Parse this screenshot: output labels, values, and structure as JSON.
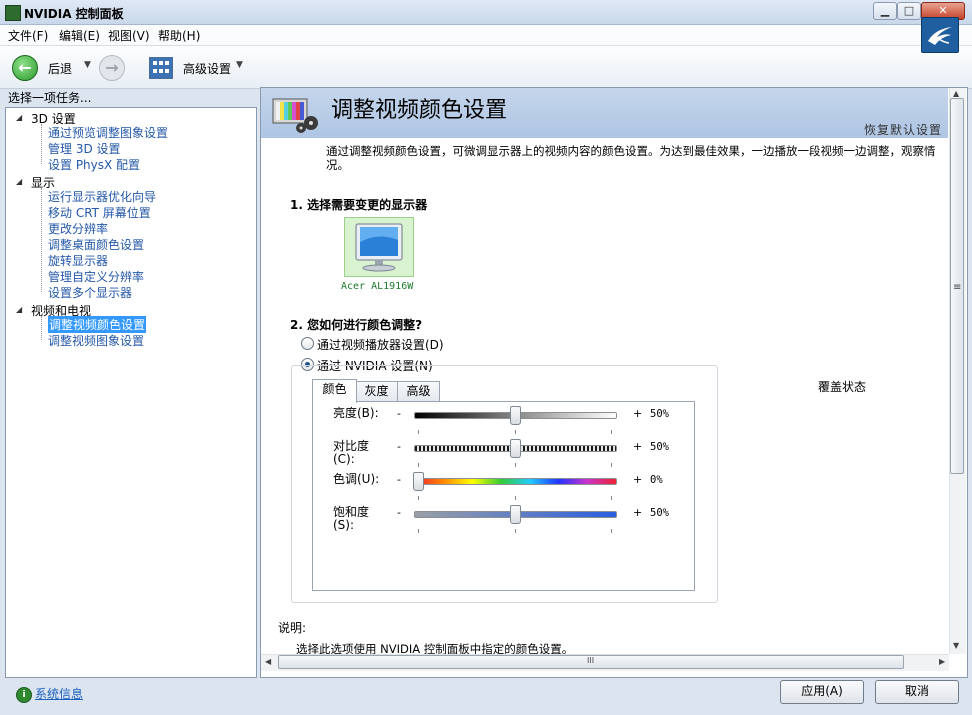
{
  "window": {
    "title": "NVIDIA 控制面板",
    "min": "▁",
    "max": "□",
    "close": "✕"
  },
  "menu": [
    "文件(F)",
    "编辑(E)",
    "视图(V)",
    "帮助(H)"
  ],
  "toolbar": {
    "back_label": "后退",
    "dropdown": "▼",
    "advanced_label": "高级设置"
  },
  "sidebar": {
    "task_label": "选择一项任务...",
    "groups": [
      {
        "label": "3D 设置",
        "toggle": "◢",
        "items": [
          "通过预览调整图象设置",
          "管理 3D 设置",
          "设置 PhysX 配置"
        ]
      },
      {
        "label": "显示",
        "toggle": "◢",
        "items": [
          "运行显示器优化向导",
          "移动 CRT 屏幕位置",
          "更改分辨率",
          "调整桌面颜色设置",
          "旋转显示器",
          "管理自定义分辨率",
          "设置多个显示器"
        ]
      },
      {
        "label": "视频和电视",
        "toggle": "◢",
        "items": [
          "调整视频颜色设置",
          "调整视频图象设置"
        ]
      }
    ],
    "selected_item": "调整视频颜色设置"
  },
  "page": {
    "title": "调整视频颜色设置",
    "restore": "恢复默认设置",
    "intro": "通过调整视频颜色设置，可微调显示器上的视频内容的颜色设置。为达到最佳效果，一边播放一段视频一边调整，观察情况。",
    "section1": "1. 选择需要变更的显示器",
    "monitor_name": "Acer AL1916W",
    "section2": "2. 您如何进行颜色调整?",
    "radio_player": "通过视频播放器设置(D)",
    "radio_nvidia": "通过 NVIDIA 设置(N)",
    "selected_radio": "nvidia",
    "tabs": [
      "颜色",
      "灰度",
      "高级"
    ],
    "active_tab": "颜色",
    "sliders": [
      {
        "label_line1": "亮度(B):",
        "label_line2": "",
        "minus": "-",
        "plus": "+",
        "value_text": "50%",
        "level": 0.5,
        "track": "brightness"
      },
      {
        "label_line1": "对比度",
        "label_line2": "(C):",
        "minus": "-",
        "plus": "+",
        "value_text": "50%",
        "level": 0.5,
        "track": "contrast"
      },
      {
        "label_line1": "色调(U):",
        "label_line2": "",
        "minus": "-",
        "plus": "+",
        "value_text": "0%",
        "level": 0.0,
        "track": "hue"
      },
      {
        "label_line1": "饱和度",
        "label_line2": "(S):",
        "minus": "-",
        "plus": "+",
        "value_text": "50%",
        "level": 0.5,
        "track": "saturation"
      }
    ],
    "override_label": "覆盖状态",
    "desc_label": "说明:",
    "desc_text": "选择此选项使用 NVIDIA 控制面板中指定的颜色设置。"
  },
  "scroll": {
    "up": "▲",
    "down": "▼",
    "left": "◀",
    "right": "▶",
    "grip_v": "≡",
    "grip_h": "III"
  },
  "footer": {
    "sysinfo": "系统信息",
    "apply": "应用(A)",
    "cancel": "取消"
  },
  "colors": {
    "header_bg": "#aec5e3",
    "selected_bg": "#3399ff",
    "link": "#1b5fbf",
    "monitor_bg": "#d9f2d0"
  }
}
